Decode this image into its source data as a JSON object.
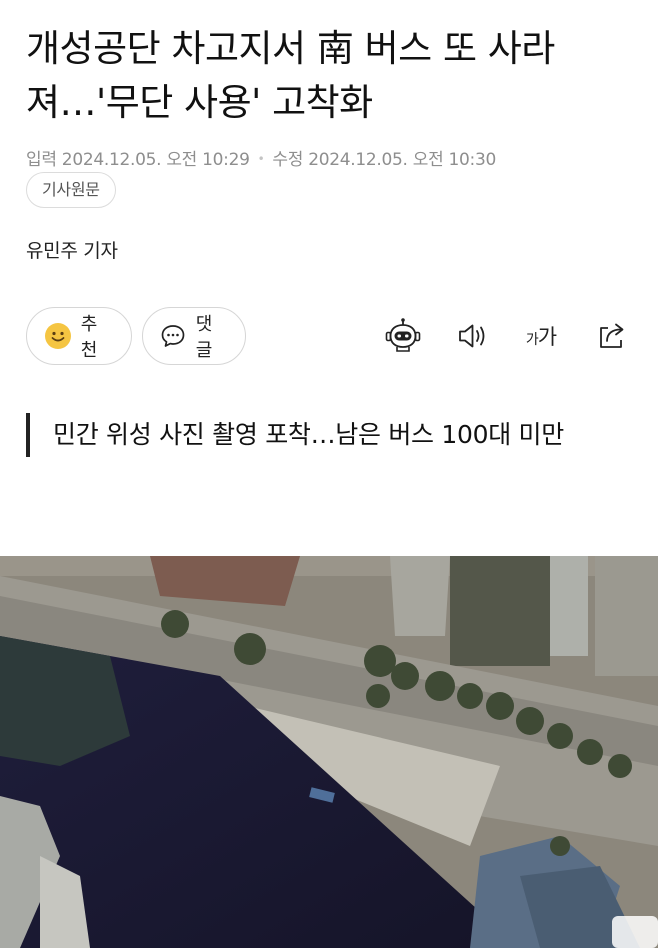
{
  "article": {
    "headline": "개성공단 차고지서 南 버스 또 사라져…'무단 사용' 고착화",
    "meta": {
      "input_label": "입력",
      "input_time": "2024.12.05. 오전 10:29",
      "modified_label": "수정",
      "modified_time": "2024.12.05. 오전 10:30"
    },
    "original_link_label": "기사원문",
    "reporter": "유민주 기자",
    "subheading": "민간 위성 사진 촬영 포착…남은 버스 100대 미만"
  },
  "actions": {
    "recommend_label": "추천",
    "comment_label": "댓글"
  },
  "toolbar": {
    "summary_icon": "robot-icon",
    "tts_icon": "speaker-icon",
    "font_size_small": "가",
    "font_size_large": "가",
    "share_icon": "share-icon"
  },
  "colors": {
    "text": "#111111",
    "meta": "#8e8e8e",
    "border": "#d6d6d6",
    "smiley": "#f5c542"
  }
}
